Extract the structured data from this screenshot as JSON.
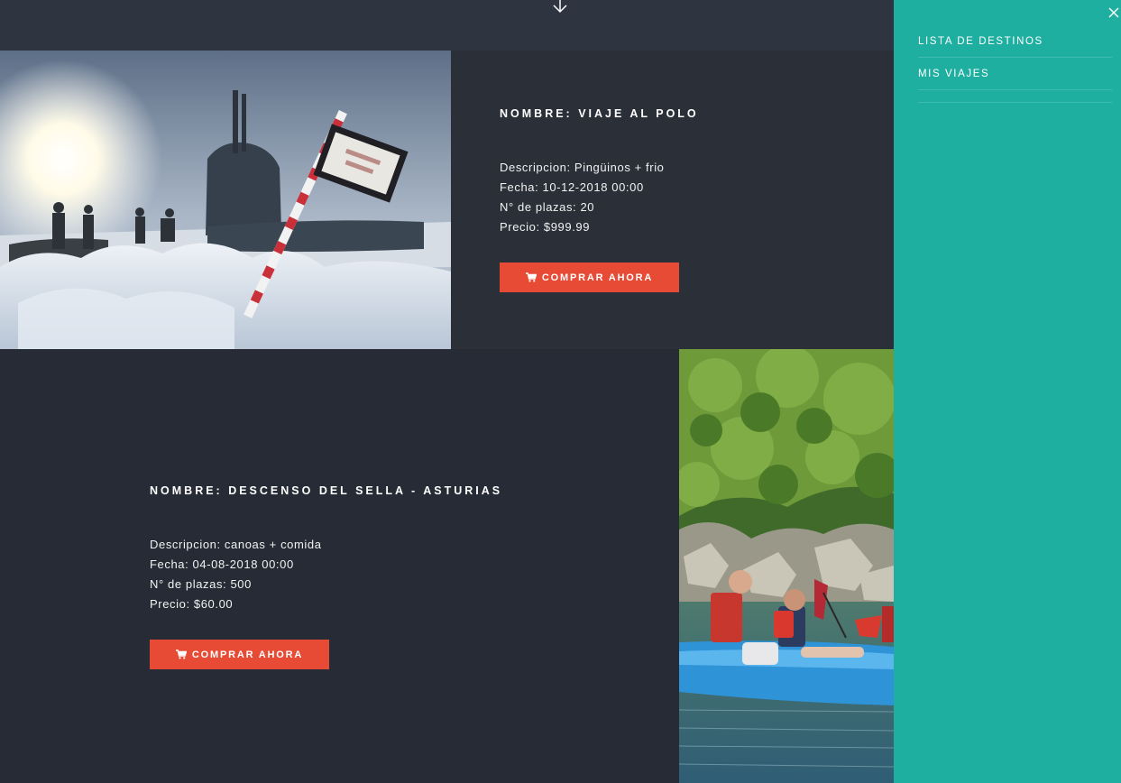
{
  "trips": [
    {
      "title": "Nombre: Viaje al Polo",
      "description": "Descripcion: Pingüinos + frio",
      "date": "Fecha: 10-12-2018 00:00",
      "seats": "N° de plazas: 20",
      "price": "Precio: $999.99",
      "buy_label": "Comprar ahora"
    },
    {
      "title": "Nombre: Descenso del Sella - Asturias",
      "description": "Descripcion: canoas + comida",
      "date": "Fecha: 04-08-2018 00:00",
      "seats": "N° de plazas: 500",
      "price": "Precio: $60.00",
      "buy_label": "Comprar ahora"
    }
  ],
  "sidebar": {
    "items": [
      {
        "label": "Lista de destinos"
      },
      {
        "label": "Mis viajes"
      }
    ]
  },
  "icons": {
    "scroll": "arrow-down-icon",
    "close": "close-icon",
    "cart": "cart-icon"
  },
  "colors": {
    "background": "#262b35",
    "sidebar": "#1fafa0",
    "button": "#e84b35"
  }
}
